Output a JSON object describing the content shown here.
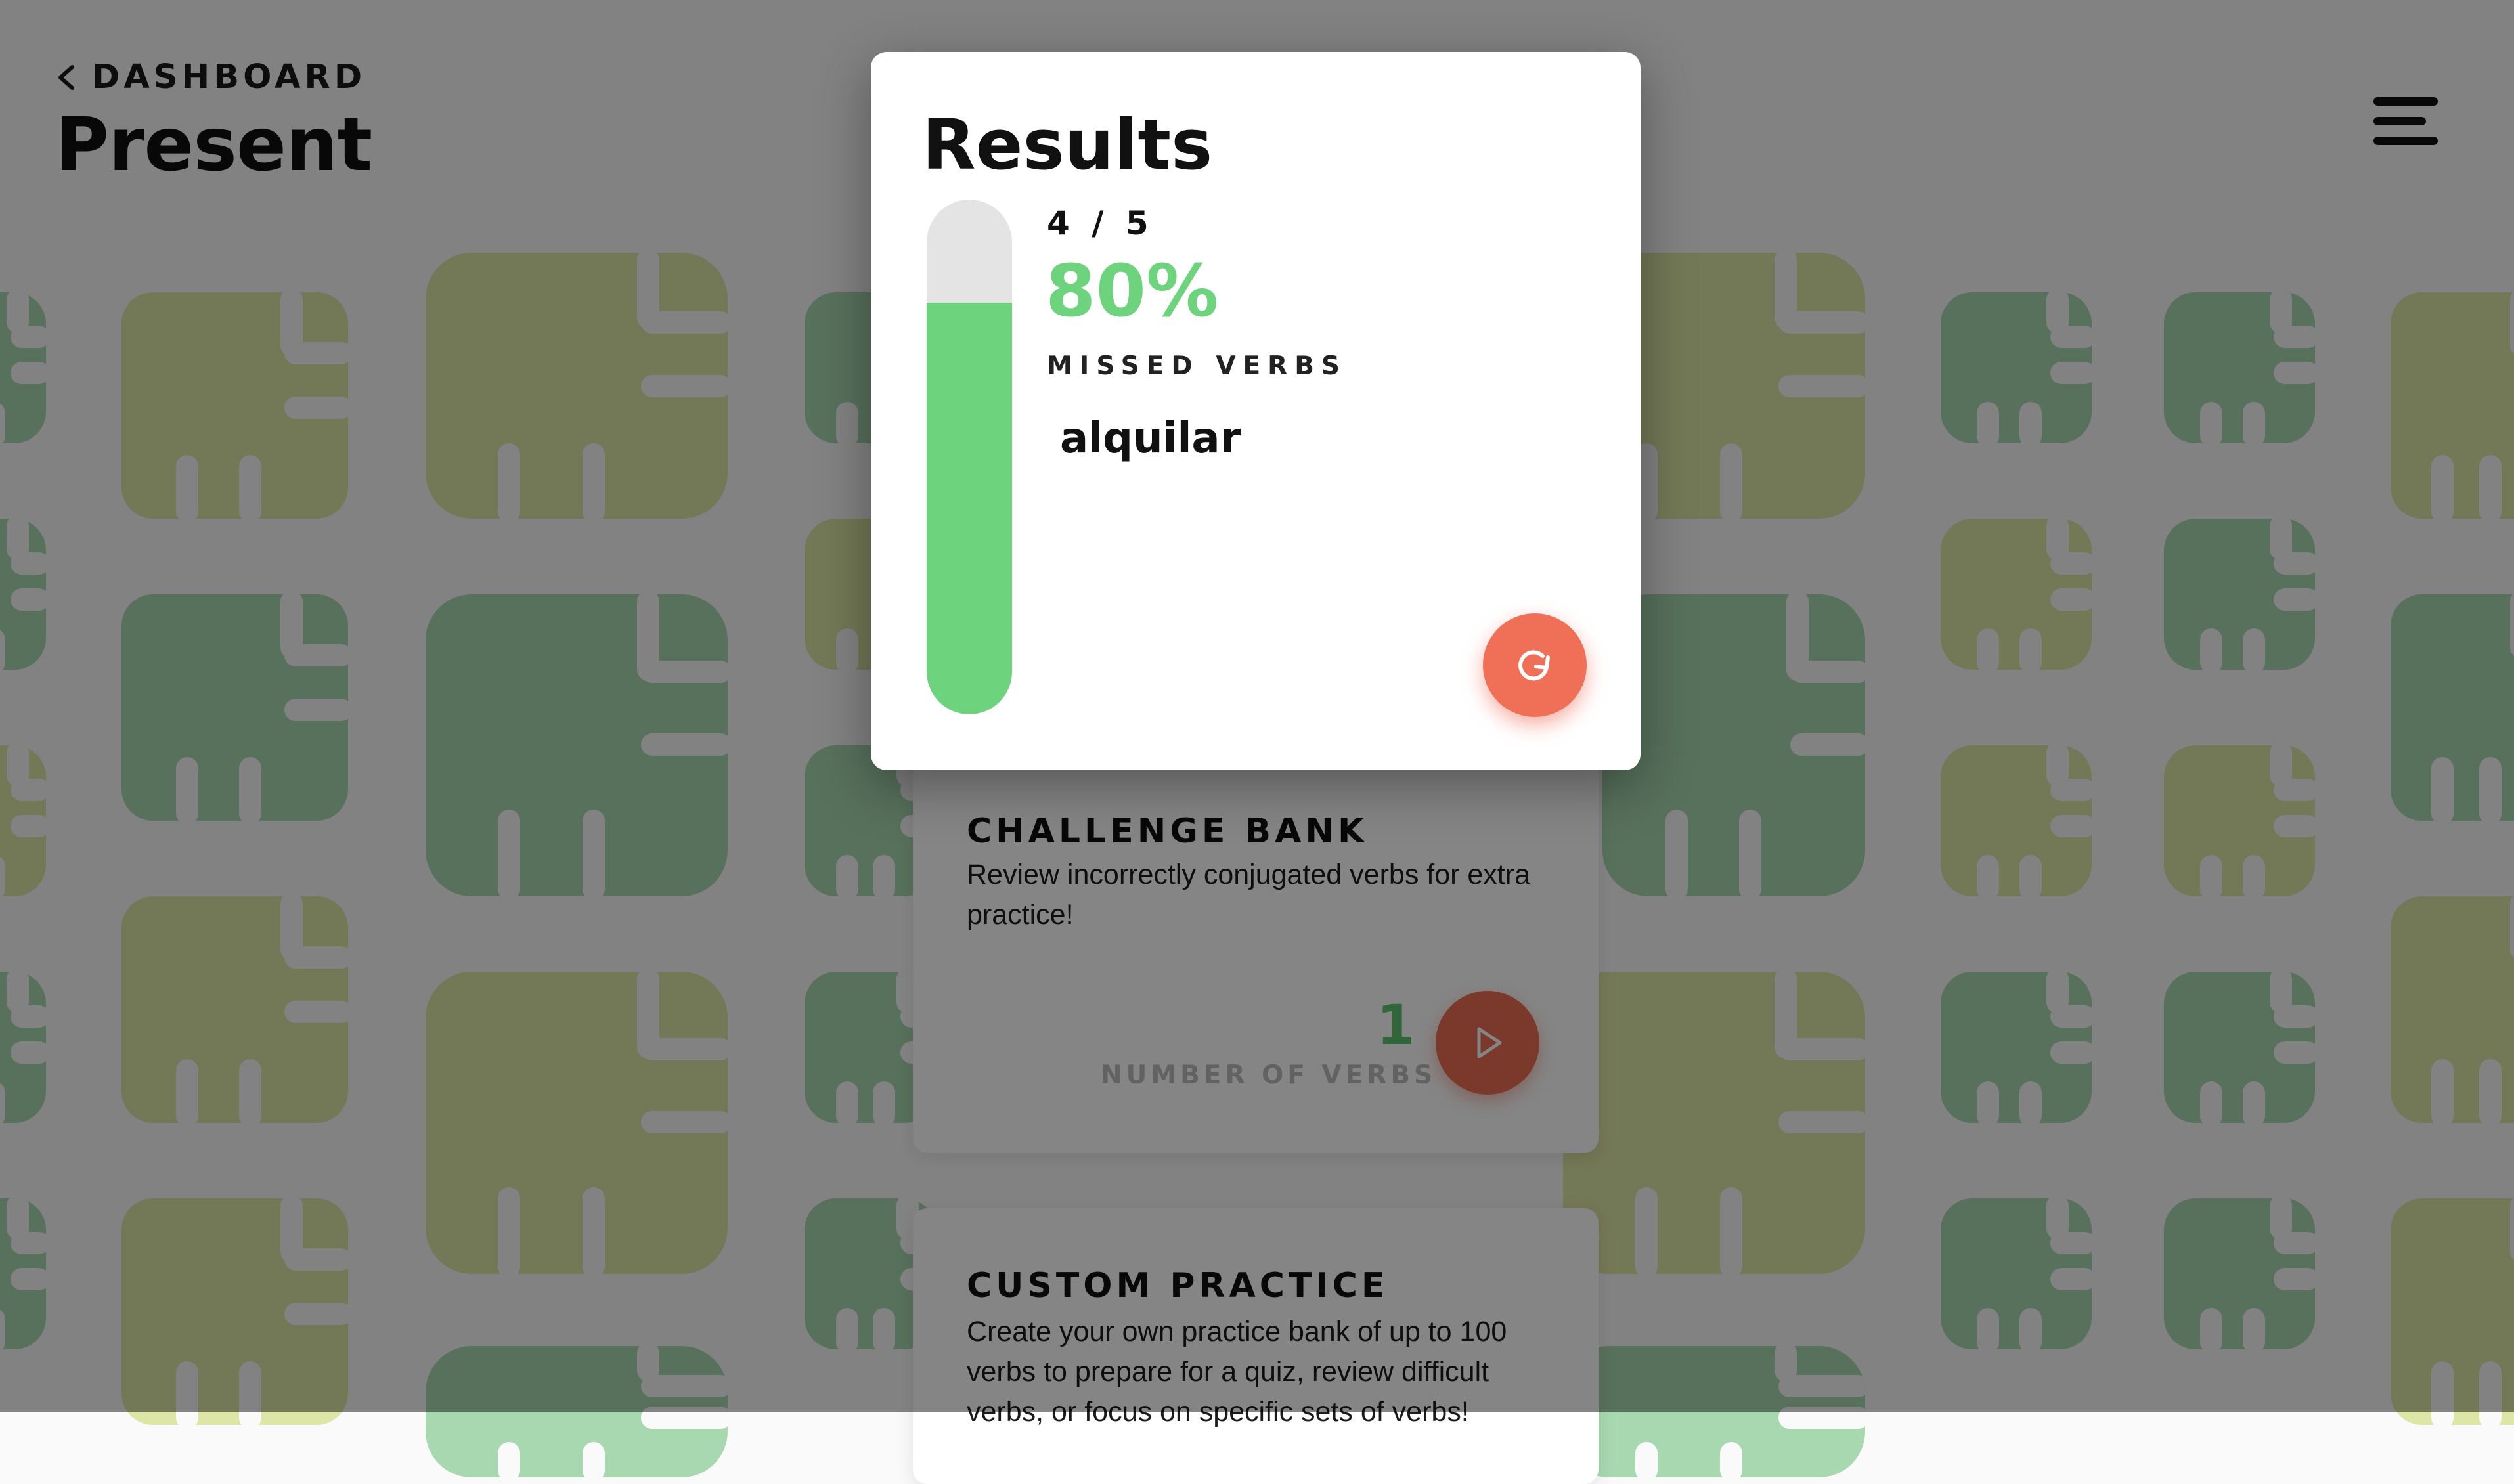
{
  "header": {
    "back_label": "DASHBOARD",
    "title": "Present"
  },
  "cards": {
    "challenge_bank": {
      "title": "CHALLENGE BANK",
      "description": "Review incorrectly conjugated verbs for extra practice!",
      "count": "1",
      "count_label": "NUMBER OF VERBS"
    },
    "custom_practice": {
      "title": "CUSTOM PRACTICE",
      "description": "Create your own practice bank of up to 100 verbs to prepare for a quiz, review difficult verbs, or focus on specific sets of verbs!"
    }
  },
  "results_modal": {
    "title": "Results",
    "score_fraction": "4 / 5",
    "score_percent": "80%",
    "score_value": 0.8,
    "missed_label": "MISSED VERBS",
    "missed_verbs": [
      "alquilar"
    ]
  },
  "icons": {
    "back": "chevron-left-icon",
    "menu": "hamburger-menu-icon",
    "play": "play-icon",
    "retry": "refresh-icon"
  },
  "colors": {
    "accent_green": "#6dd37d",
    "accent_coral": "#ef6f57",
    "pattern_green": "#a8d8b0",
    "pattern_yellow": "#dde6a6",
    "track_gray": "#e4e4e4"
  }
}
